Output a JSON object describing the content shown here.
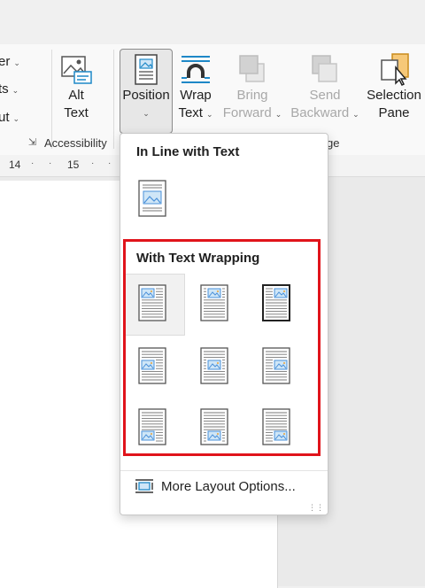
{
  "ribbon": {
    "left_labels": [
      "er",
      "ts",
      "ut"
    ],
    "alt_text": {
      "line1": "Alt",
      "line2": "Text"
    },
    "accessibility_group": "Accessibility",
    "position": {
      "label": "Position"
    },
    "wrap_text": {
      "line1": "Wrap",
      "line2": "Text"
    },
    "bring_forward": {
      "line1": "Bring",
      "line2": "Forward"
    },
    "send_backward": {
      "line1": "Send",
      "line2": "Backward"
    },
    "selection_pane": {
      "line1": "Selection",
      "line2": "Pane"
    },
    "arrange_group_partial": "ge"
  },
  "ruler": {
    "n14": "14",
    "n15": "15"
  },
  "position_menu": {
    "inline_heading": "In Line with Text",
    "wrapping_heading": "With Text Wrapping",
    "more_options": "More Layout Options...",
    "colors": {
      "highlight": "#e0141b",
      "picture": "#4a90d9"
    }
  }
}
